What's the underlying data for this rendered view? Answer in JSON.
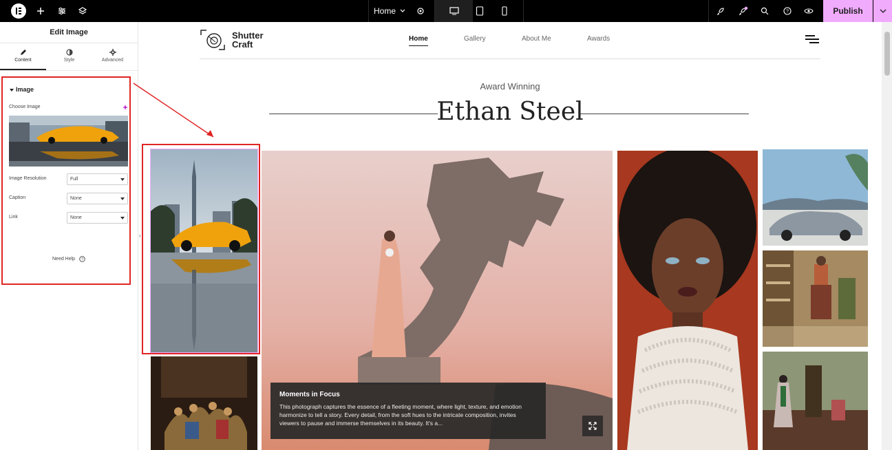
{
  "topbar": {
    "page_selector": "Home",
    "publish_label": "Publish",
    "icons": [
      "elementor-logo-icon",
      "add-icon",
      "settings-sliders-icon",
      "layers-icon",
      "page-settings-icon",
      "desktop-icon",
      "tablet-icon",
      "mobile-icon",
      "rocket-icon",
      "notifications-icon",
      "search-icon",
      "help-icon",
      "preview-eye-icon",
      "chevron-down-icon"
    ]
  },
  "panel": {
    "title": "Edit Image",
    "tabs": [
      {
        "label": "Content",
        "icon": "pencil-icon"
      },
      {
        "label": "Style",
        "icon": "half-circle-icon"
      },
      {
        "label": "Advanced",
        "icon": "gear-icon"
      }
    ],
    "section_title": "Image",
    "choose_image_label": "Choose Image",
    "fields": [
      {
        "label": "Image Resolution",
        "value": "Full"
      },
      {
        "label": "Caption",
        "value": "None"
      },
      {
        "label": "Link",
        "value": "None"
      }
    ],
    "need_help": "Need Help"
  },
  "site": {
    "logo_line1": "Shutter",
    "logo_line2": "Craft",
    "nav": [
      "Home",
      "Gallery",
      "About Me",
      "Awards"
    ],
    "kicker": "Award Winning",
    "heading": "Ethan Steel",
    "caption_title": "Moments in Focus",
    "caption_text": "This photograph captures the essence of a fleeting moment, where light, texture, and emotion harmonize to tell a story. Every detail, from the soft hues to the intricate composition, invites viewers to pause and immerse themselves in its beauty. It's a..."
  },
  "colors": {
    "accent_pink": "#f0abfc",
    "highlight_red": "#e02424",
    "topbar_bg": "#000000"
  }
}
